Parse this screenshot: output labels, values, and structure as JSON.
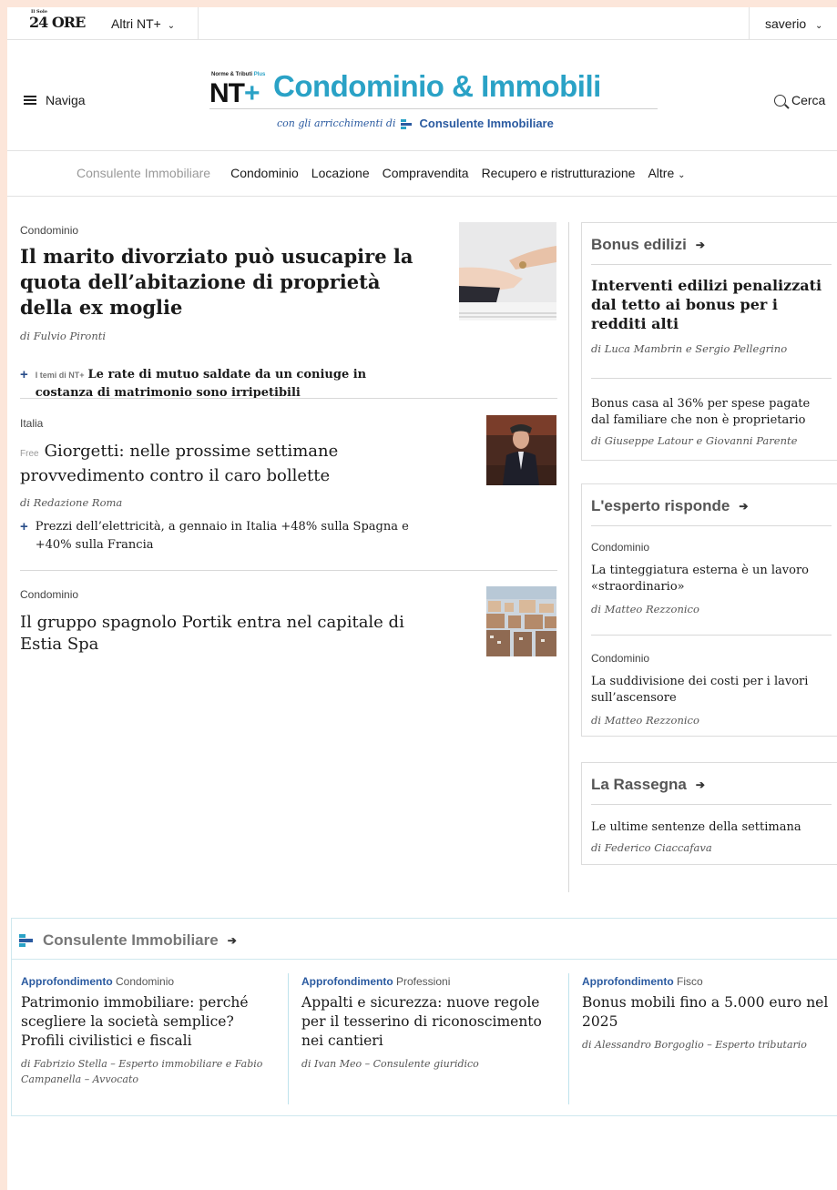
{
  "topbar": {
    "logo": "24 ORE",
    "logo_sup": "Il Sole",
    "altri": "Altri NT+",
    "user": "saverio"
  },
  "header": {
    "menu_label": "Naviga",
    "brand_small": "Norme & Tributi",
    "brand_small_plus": "Plus",
    "brand_nt": "NT",
    "brand_plus": "+",
    "brand_title": "Condominio & Immobili",
    "tagline": "con gli arricchimenti di",
    "tagline_brand": "Consulente Immobiliare",
    "search_label": "Cerca"
  },
  "nav": {
    "section": "Consulente Immobiliare",
    "items": [
      "Condominio",
      "Locazione",
      "Compravendita",
      "Recupero e ristrutturazione",
      "Altre"
    ]
  },
  "articles": [
    {
      "category": "Condominio",
      "title": "Il marito divorziato può usucapire la quota dell’abitazione di proprietà della ex moglie",
      "byline": "di Fulvio Pironti",
      "related_tag": "I temi di NT+",
      "related": "Le rate di mutuo saldate da un coniuge in costanza di matrimonio sono irripetibili"
    },
    {
      "category": "Italia",
      "badge": "Free",
      "title": "Giorgetti: nelle prossime settimane provvedimento contro il caro bollette",
      "byline": "di Redazione Roma",
      "related": "Prezzi dell’elettricità, a gennaio in Italia +48% sulla Spagna e +40% sulla Francia"
    },
    {
      "category": "Condominio",
      "title": "Il gruppo spagnolo Portik entra nel capitale di Estia Spa"
    }
  ],
  "sidebar": {
    "bonus": {
      "title": "Bonus edilizi",
      "items": [
        {
          "title": "Interventi edilizi penalizzati dal tetto ai bonus per i redditi alti",
          "byline": "di Luca Mambrin e Sergio Pellegrino"
        },
        {
          "title": "Bonus casa al 36% per spese pagate dal familiare che non è proprietario",
          "byline": "di Giuseppe Latour e Giovanni Parente"
        }
      ]
    },
    "esperto": {
      "title": "L'esperto risponde",
      "items": [
        {
          "category": "Condominio",
          "title": "La tinteggiatura esterna è un lavoro «straordinario»",
          "byline": "di Matteo Rezzonico"
        },
        {
          "category": "Condominio",
          "title": "La suddivisione dei costi per i lavori sull’ascensore",
          "byline": "di Matteo Rezzonico"
        }
      ]
    },
    "rassegna": {
      "title": "La Rassegna",
      "items": [
        {
          "title": "Le ultime sentenze della settimana",
          "byline": "di Federico Ciaccafava"
        }
      ]
    }
  },
  "consulente": {
    "title": "Consulente Immobiliare",
    "items": [
      {
        "label": "Approfondimento",
        "topic": "Condominio",
        "title": "Patrimonio immobiliare: perché scegliere la società semplice? Profili civilistici e fiscali",
        "byline": "di Fabrizio Stella – Esperto immobiliare e Fabio Campanella – Avvocato"
      },
      {
        "label": "Approfondimento",
        "topic": "Professioni",
        "title": "Appalti e sicurezza: nuove regole per il tesserino di riconoscimento nei cantieri",
        "byline": "di Ivan Meo – Consulente giuridico"
      },
      {
        "label": "Approfondimento",
        "topic": "Fisco",
        "title": "Bonus mobili fino a 5.000 euro nel 2025",
        "byline": "di Alessandro Borgoglio – Esperto tributario"
      }
    ]
  },
  "colors": {
    "accent": "#2aa2c6",
    "brand_blue": "#2a5aa0",
    "page_bg": "#fce6da"
  }
}
